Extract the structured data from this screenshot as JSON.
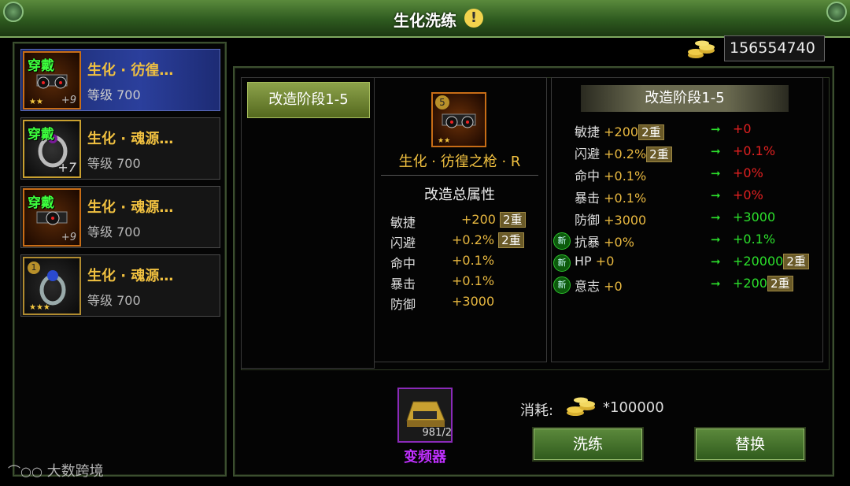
{
  "window": {
    "title": "生化洗练"
  },
  "gold": {
    "amount": "156554740",
    "icon": "gold-coins-icon"
  },
  "item_list": [
    {
      "name": "生化 · 彷徨…",
      "level": "等级 700",
      "wear": "穿戴",
      "plus": "+9",
      "type": "weapon",
      "selected": true
    },
    {
      "name": "生化 · 魂源…",
      "level": "等级 700",
      "wear": "穿戴",
      "plus": "+7",
      "type": "ring",
      "selected": false
    },
    {
      "name": "生化 · 魂源…",
      "level": "等级 700",
      "wear": "穿戴",
      "plus": "+9",
      "type": "weapon",
      "selected": false
    },
    {
      "name": "生化 · 魂源…",
      "level": "等级 700",
      "wear": "",
      "plus": "",
      "badge": "1",
      "type": "ring",
      "selected": false
    }
  ],
  "stage_tab": {
    "label": "改造阶段1-5"
  },
  "weapon": {
    "name": "生化 · 彷徨之枪 · R",
    "badge": "5"
  },
  "total_stats": {
    "header": "改造总属性",
    "rows": [
      {
        "name": "敏捷",
        "value": "+200",
        "tag": "2重"
      },
      {
        "name": "闪避",
        "value": "+0.2%",
        "tag": "2重"
      },
      {
        "name": "命中",
        "value": "+0.1%",
        "tag": ""
      },
      {
        "name": "暴击",
        "value": "+0.1%",
        "tag": ""
      },
      {
        "name": "防御",
        "value": "+3000",
        "tag": ""
      }
    ]
  },
  "stage_stats": {
    "header": "改造阶段1-5",
    "rows": [
      {
        "name": "敏捷",
        "cur": "+200",
        "cur_tag": "2重",
        "new": "+0",
        "new_color": "red",
        "new_tag": "",
        "is_new": false
      },
      {
        "name": "闪避",
        "cur": "+0.2%",
        "cur_tag": "2重",
        "new": "+0.1%",
        "new_color": "red",
        "new_tag": "",
        "is_new": false
      },
      {
        "name": "命中",
        "cur": "+0.1%",
        "cur_tag": "",
        "new": "+0%",
        "new_color": "red",
        "new_tag": "",
        "is_new": false
      },
      {
        "name": "暴击",
        "cur": "+0.1%",
        "cur_tag": "",
        "new": "+0%",
        "new_color": "red",
        "new_tag": "",
        "is_new": false
      },
      {
        "name": "防御",
        "cur": "+3000",
        "cur_tag": "",
        "new": "+3000",
        "new_color": "green",
        "new_tag": "",
        "is_new": false
      },
      {
        "name": "抗暴",
        "cur": "+0%",
        "cur_tag": "",
        "new": "+0.1%",
        "new_color": "green",
        "new_tag": "",
        "is_new": true
      },
      {
        "name": "HP",
        "cur": "+0",
        "cur_tag": "",
        "new": "+20000",
        "new_color": "green",
        "new_tag": "2重",
        "is_new": true
      },
      {
        "name": "意志",
        "cur": "+0",
        "cur_tag": "",
        "new": "+200",
        "new_color": "green",
        "new_tag": "2重",
        "is_new": true
      }
    ]
  },
  "material": {
    "name": "变频器",
    "count": "981/2"
  },
  "cost": {
    "label": "消耗:",
    "value": "*100000"
  },
  "buttons": {
    "wash": "洗练",
    "replace": "替换"
  },
  "watermark": "大数跨境",
  "colors": {
    "title_bar": "#3a6a28",
    "gold_text": "#f0c040",
    "increase": "#2ce02c",
    "decrease": "#e22020",
    "material_purple": "#c030ff"
  }
}
